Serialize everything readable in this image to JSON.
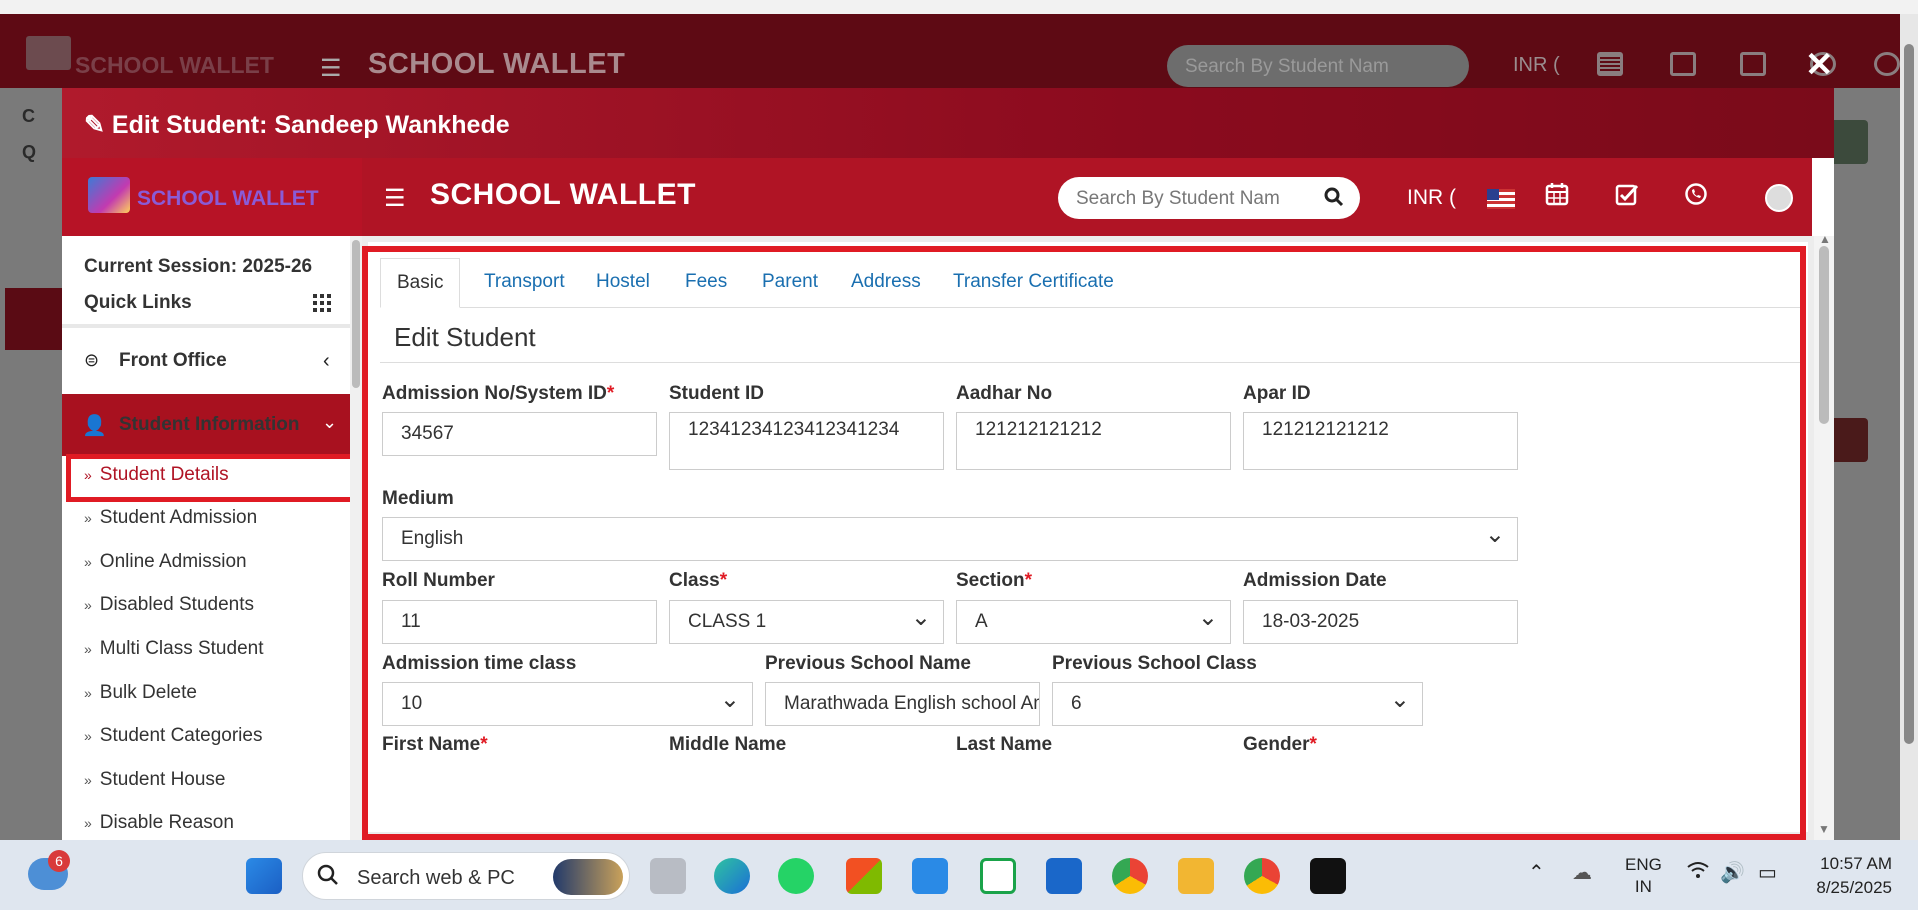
{
  "background": {
    "brand": "SCHOOL WALLET",
    "title": "SCHOOL WALLET",
    "search_placeholder": "Search By Student Nam",
    "currency": "INR ("
  },
  "modal": {
    "title": "Edit Student: Sandeep Wankhede",
    "close_symbol": "✕"
  },
  "inner_header": {
    "brand": "SCHOOL WALLET",
    "title": "SCHOOL WALLET",
    "search_placeholder": "Search By Student Nam",
    "currency": "INR ("
  },
  "sidebar": {
    "session": "Current Session: 2025-26",
    "quick_links": "Quick Links",
    "front_office": "Front Office",
    "student_information": "Student Information",
    "items": [
      {
        "label": "Student Details",
        "active": true
      },
      {
        "label": "Student Admission"
      },
      {
        "label": "Online Admission"
      },
      {
        "label": "Disabled Students"
      },
      {
        "label": "Multi Class Student"
      },
      {
        "label": "Bulk Delete"
      },
      {
        "label": "Student Categories"
      },
      {
        "label": "Student House"
      },
      {
        "label": "Disable Reason"
      }
    ]
  },
  "tabs": [
    "Basic",
    "Transport",
    "Hostel",
    "Fees",
    "Parent",
    "Address",
    "Transfer Certificate"
  ],
  "form": {
    "heading": "Edit Student",
    "admission_no": {
      "label": "Admission No/System ID",
      "value": "34567"
    },
    "student_id": {
      "label": "Student ID",
      "value": "12341234123412341234"
    },
    "aadhar_no": {
      "label": "Aadhar No",
      "value": "121212121212"
    },
    "apar_id": {
      "label": "Apar ID",
      "value": "121212121212"
    },
    "medium": {
      "label": "Medium",
      "value": "English"
    },
    "roll_number": {
      "label": "Roll Number",
      "value": "11"
    },
    "class": {
      "label": "Class",
      "value": "CLASS 1"
    },
    "section": {
      "label": "Section",
      "value": "A"
    },
    "admission_date": {
      "label": "Admission Date",
      "value": "18-03-2025"
    },
    "admission_time_class": {
      "label": "Admission time class",
      "value": "10"
    },
    "previous_school_name": {
      "label": "Previous School Name",
      "value": "Marathwada English school Amth"
    },
    "previous_school_class": {
      "label": "Previous School Class",
      "value": "6"
    },
    "first_name": {
      "label": "First Name"
    },
    "middle_name": {
      "label": "Middle Name"
    },
    "last_name": {
      "label": "Last Name"
    },
    "gender": {
      "label": "Gender"
    },
    "required_mark": "*"
  },
  "taskbar": {
    "notification_count": "6",
    "search_text": "Search web & PC",
    "lang_top": "ENG",
    "lang_bottom": "IN",
    "time": "10:57 AM",
    "date": "8/25/2025"
  },
  "colors": {
    "brand_red": "#b01425",
    "highlight": "#e01b24",
    "link": "#1a6fb0"
  }
}
